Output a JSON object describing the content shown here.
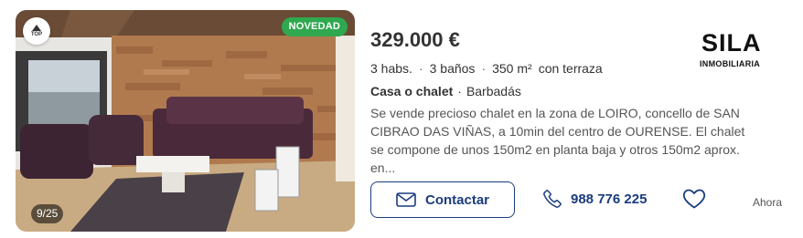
{
  "listing": {
    "image": {
      "top_badge": "TOP",
      "new_badge": "NOVEDAD",
      "counter": "9/25"
    },
    "price": "329.000 €",
    "specs": [
      "3 habs.",
      "3 baños",
      "350 m²",
      "con terraza"
    ],
    "property_type": "Casa o chalet",
    "location": "Barbadás",
    "description": "Se vende precioso chalet en la zona de LOIRO, concello de SAN CIBRAO DAS VIÑAS, a 10min del centro de OURENSE. El chalet se compone de unos 150m2 en planta baja y otros 150m2 aprox. en...",
    "agency": {
      "logo_text": "SILA",
      "logo_subtext": "INMOBILIARIA"
    },
    "actions": {
      "contact_label": "Contactar",
      "phone": "988 776 225"
    },
    "time": "Ahora"
  },
  "colors": {
    "brand": "#1a3c7e",
    "new_badge": "#2fa84f"
  },
  "icons": [
    "top-arrow-icon",
    "mail-icon",
    "phone-icon",
    "heart-icon"
  ]
}
